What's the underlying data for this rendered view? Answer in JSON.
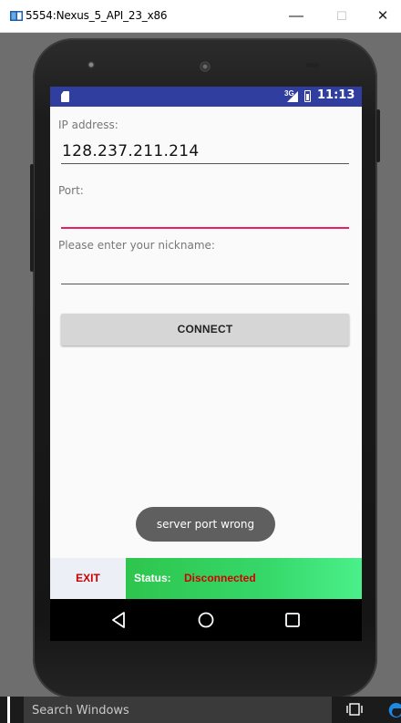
{
  "window": {
    "title": "5554:Nexus_5_API_23_x86",
    "minimize_glyph": "—",
    "maximize_glyph": "☐",
    "close_glyph": "✕"
  },
  "status_bar": {
    "network": "3G",
    "time": "11:13"
  },
  "form": {
    "ip_label": "IP address:",
    "ip_value": "128.237.211.214",
    "port_label": "Port:",
    "port_value": "",
    "nickname_label": "Please enter your nickname:",
    "nickname_value": "",
    "connect_label": "CONNECT"
  },
  "toast": {
    "message": "server port wrong"
  },
  "bottom": {
    "exit_label": "EXIT",
    "status_label": "Status:",
    "status_value": "Disconnected"
  },
  "taskbar": {
    "search_placeholder": "Search Windows"
  },
  "colors": {
    "status_bar": "#303f9f",
    "accent_underline": "#e91e63",
    "status_panel": "#36d86a",
    "status_value_text": "#d10000",
    "exit_text": "#cc0000"
  },
  "icons": {
    "app": "emulator-window-icon",
    "sd_card": "sd-card-icon",
    "signal": "signal-icon",
    "battery": "battery-icon",
    "back": "back-triangle-icon",
    "home": "home-circle-icon",
    "recents": "recents-square-icon",
    "task_view": "task-view-icon",
    "edge": "edge-browser-icon"
  }
}
